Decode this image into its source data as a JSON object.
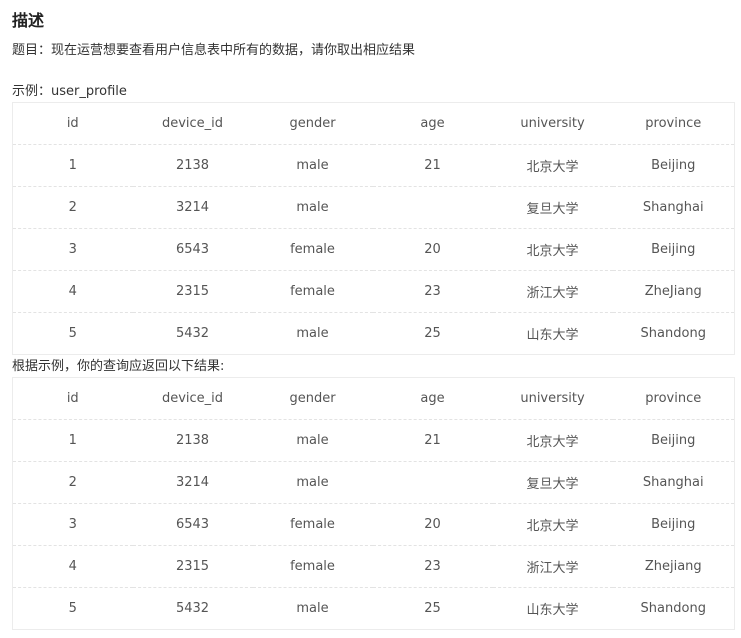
{
  "description": {
    "heading": "描述",
    "problem": "题目：现在运营想要查看用户信息表中所有的数据，请你取出相应结果"
  },
  "example": {
    "label": "示例：user_profile",
    "columns": [
      "id",
      "device_id",
      "gender",
      "age",
      "university",
      "province"
    ],
    "rows": [
      [
        "1",
        "2138",
        "male",
        "21",
        "北京大学",
        "Beijing"
      ],
      [
        "2",
        "3214",
        "male",
        "",
        "复旦大学",
        "Shanghai"
      ],
      [
        "3",
        "6543",
        "female",
        "20",
        "北京大学",
        "Beijing"
      ],
      [
        "4",
        "2315",
        "female",
        "23",
        "浙江大学",
        "ZheJiang"
      ],
      [
        "5",
        "5432",
        "male",
        "25",
        "山东大学",
        "Shandong"
      ]
    ]
  },
  "result": {
    "label": "根据示例，你的查询应返回以下结果:",
    "columns": [
      "id",
      "device_id",
      "gender",
      "age",
      "university",
      "province"
    ],
    "rows": [
      [
        "1",
        "2138",
        "male",
        "21",
        "北京大学",
        "Beijing"
      ],
      [
        "2",
        "3214",
        "male",
        "",
        "复旦大学",
        "Shanghai"
      ],
      [
        "3",
        "6543",
        "female",
        "20",
        "北京大学",
        "Beijing"
      ],
      [
        "4",
        "2315",
        "female",
        "23",
        "浙江大学",
        "Zhejiang"
      ],
      [
        "5",
        "5432",
        "male",
        "25",
        "山东大学",
        "Shandong"
      ]
    ]
  }
}
